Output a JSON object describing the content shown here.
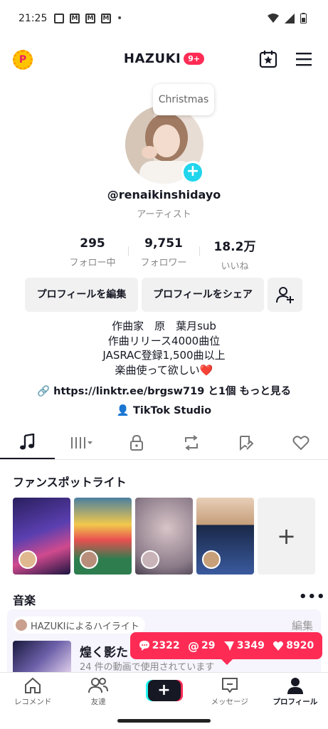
{
  "status": {
    "time": "21:25",
    "notif_icons": [
      "photo-icon",
      "gmail-icon",
      "gmail-icon",
      "gmail-icon"
    ],
    "dot": "•"
  },
  "header": {
    "coin_icon": "P",
    "title": "HAZUKI",
    "badge": "9+"
  },
  "avatar": {
    "bubble": "Christmas"
  },
  "profile": {
    "username": "@renaikinshidayo",
    "category": "アーティスト",
    "stats": [
      {
        "num": "295",
        "label": "フォロー中"
      },
      {
        "num": "9,751",
        "label": "フォロワー"
      },
      {
        "num": "18.2万",
        "label": "いいね"
      }
    ],
    "edit_label": "プロフィールを編集",
    "share_label": "プロフィールをシェア",
    "bio": [
      "作曲家　原　葉月sub",
      "作曲リリース4000曲位",
      "JASRAC登録1,500曲以上",
      "楽曲使って欲しい❤️"
    ],
    "link": "https://linktr.ee/brgsw719 と1個 もっと見る",
    "studio": "TikTok Studio"
  },
  "spotlight": {
    "title": "ファンスポットライト",
    "add": "+"
  },
  "music": {
    "title": "音楽",
    "more": "•••",
    "highlight_tag": "HAZUKIによるハイライト",
    "edit": "編集",
    "song_title": "煌く影た",
    "song_sub": "24 件の動画で使用されています"
  },
  "popup": {
    "comments": "2322",
    "mentions": "29",
    "shares": "3349",
    "likes": "8920"
  },
  "nav": {
    "home": "レコメンド",
    "friends": "友達",
    "create": "+",
    "inbox": "メッセージ",
    "profile": "プロフィール"
  },
  "colors": {
    "accent": "#fe2c55",
    "cyan": "#20d5ec"
  }
}
